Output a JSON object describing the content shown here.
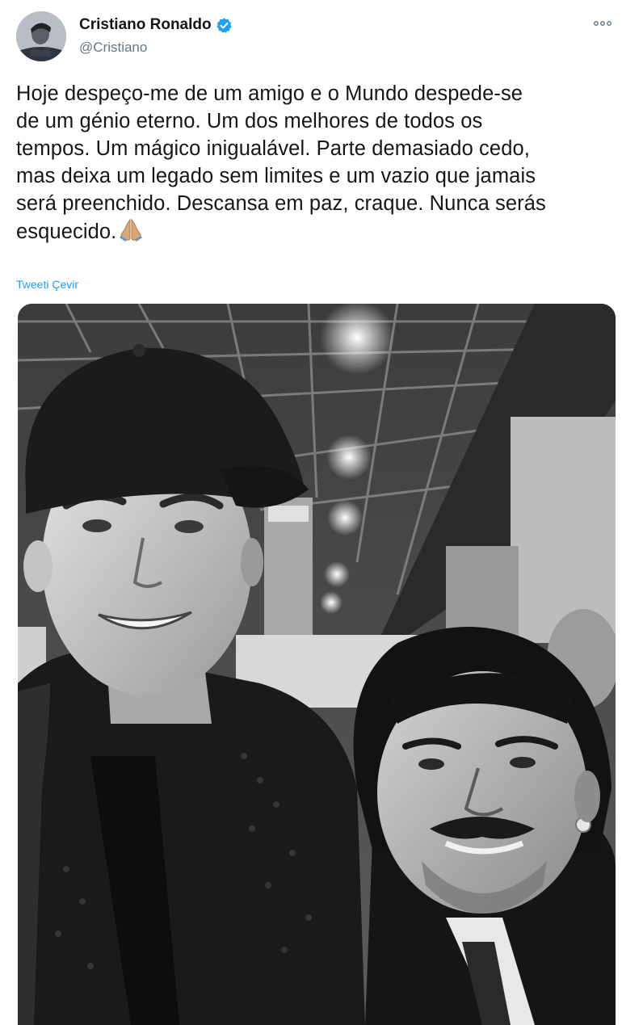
{
  "author": {
    "name": "Cristiano Ronaldo",
    "handle": "@Cristiano",
    "verified": true,
    "avatar_icon": "profile-photo"
  },
  "tweet": {
    "lines": [
      "Hoje despeço-me de um amigo e o Mundo despede-se",
      "de um génio eterno. Um dos melhores de todos os",
      "tempos. Um mágico inigualável. Parte demasiado cedo,",
      "mas deixa um legado sem limites e um vazio que jamais",
      "será preenchido. Descansa em paz, craque. Nunca serás",
      "esquecido."
    ],
    "emoji": "folded-hands",
    "translate_label": "Tweeti Çevir"
  },
  "media": {
    "kind": "black-and-white-photo",
    "subject": "two-men-selfie"
  },
  "colors": {
    "text": "#14171a",
    "secondary": "#657786",
    "link": "#1da1f2",
    "verified": "#1da1f2"
  }
}
